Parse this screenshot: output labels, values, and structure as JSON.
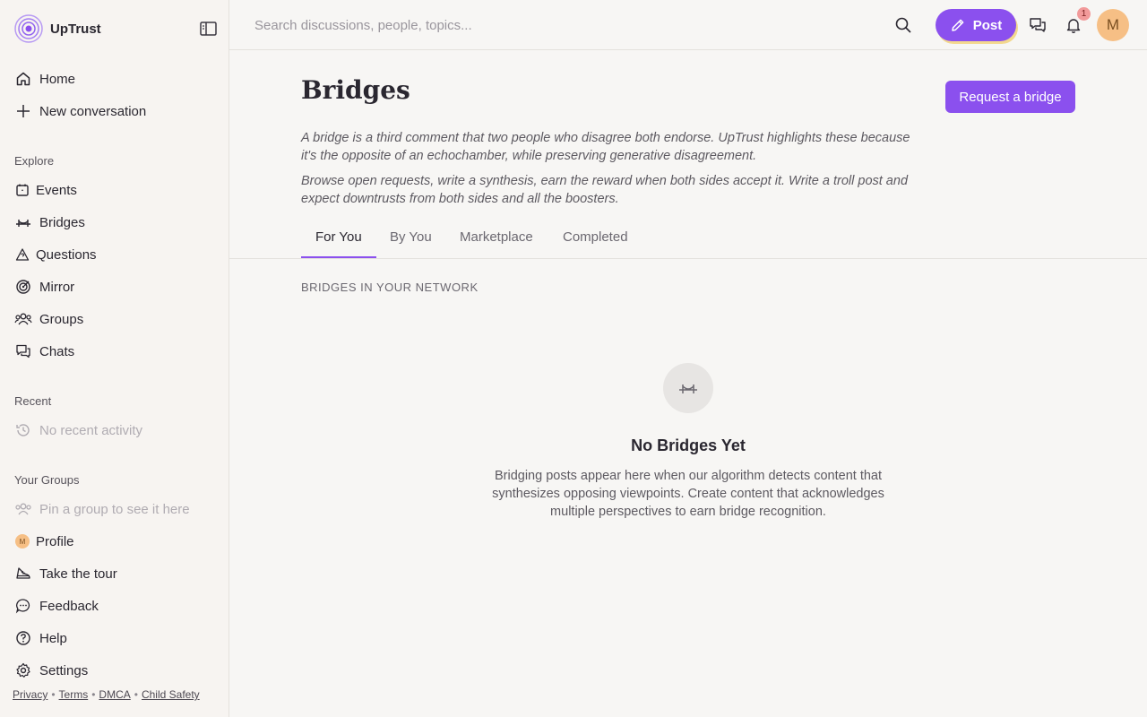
{
  "brand": {
    "name": "UpTrust",
    "logo_icon": "uptrust-logo-icon"
  },
  "sidebar": {
    "primary": [
      {
        "label": "Home",
        "icon": "home-icon"
      },
      {
        "label": "New conversation",
        "icon": "plus-icon"
      }
    ],
    "explore_label": "Explore",
    "explore": [
      {
        "label": "Events",
        "icon": "calendar-icon"
      },
      {
        "label": "Bridges",
        "icon": "bridge-icon"
      },
      {
        "label": "Questions",
        "icon": "triangle-question-icon"
      },
      {
        "label": "Mirror",
        "icon": "target-icon"
      },
      {
        "label": "Groups",
        "icon": "users-icon"
      },
      {
        "label": "Chats",
        "icon": "chat-bubbles-icon"
      }
    ],
    "recent_label": "Recent",
    "recent_empty": "No recent activity",
    "groups_label": "Your Groups",
    "groups_empty": "Pin a group to see it here",
    "bottom": [
      {
        "label": "Profile",
        "icon": "avatar-icon"
      },
      {
        "label": "Take the tour",
        "icon": "shoe-icon"
      },
      {
        "label": "Feedback",
        "icon": "message-dots-icon"
      },
      {
        "label": "Help",
        "icon": "question-circle-icon"
      },
      {
        "label": "Settings",
        "icon": "gear-icon"
      }
    ],
    "footer_links": [
      "Privacy",
      "Terms",
      "DMCA",
      "Child Safety"
    ]
  },
  "topbar": {
    "search_placeholder": "Search discussions, people, topics...",
    "post_label": "Post",
    "notification_count": "1",
    "avatar_initial": "M"
  },
  "page": {
    "title": "Bridges",
    "request_button": "Request a bridge",
    "description_1": "A bridge is a third comment that two people who disagree both endorse. UpTrust highlights these because it's the opposite of an echochamber, while preserving generative disagreement.",
    "description_2": "Browse open requests, write a synthesis, earn the reward when both sides accept it. Write a troll post and expect downtrusts from both sides and all the boosters.",
    "tabs": [
      "For You",
      "By You",
      "Marketplace",
      "Completed"
    ],
    "active_tab": "For You",
    "section_label": "BRIDGES IN YOUR NETWORK",
    "empty_title": "No Bridges Yet",
    "empty_text": "Bridging posts appear here when our algorithm detects content that synthesizes opposing viewpoints. Create content that acknowledges multiple perspectives to earn bridge recognition."
  },
  "colors": {
    "accent": "#8b50ee",
    "background": "#f7f6f4",
    "badge": "#f29a9a",
    "avatar": "#f6bf85"
  }
}
